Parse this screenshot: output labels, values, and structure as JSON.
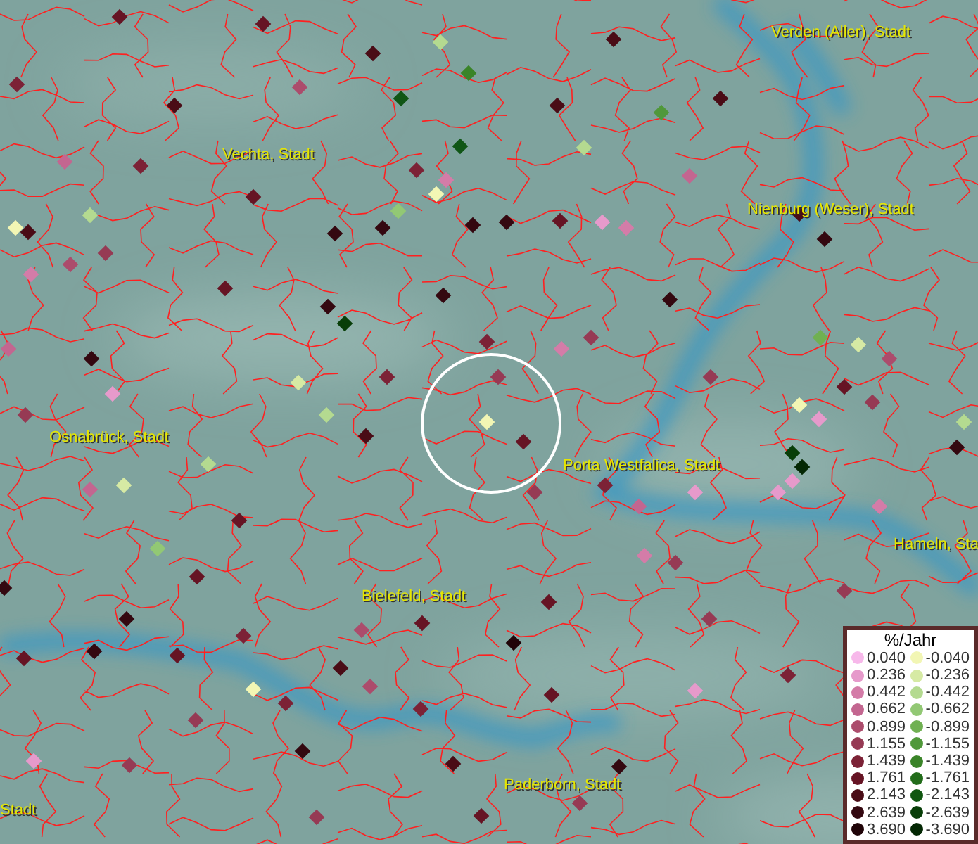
{
  "cities": [
    {
      "name": "Verden (Aller), Stadt"
    },
    {
      "name": "Vechta, Stadt"
    },
    {
      "name": "Nienburg (Weser), Stadt"
    },
    {
      "name": "Osnabrück, Stadt"
    },
    {
      "name": "Porta Westfalica, Stadt"
    },
    {
      "name": "Hameln, Sta"
    },
    {
      "name": "Bielefeld, Stadt"
    },
    {
      "name": "Paderborn, Stadt"
    },
    {
      "name": "Stadt"
    }
  ],
  "legend": {
    "title": "%/Jahr",
    "rows": [
      {
        "positive": {
          "label": "0.040",
          "color": "#f7b8ea"
        },
        "negative": {
          "label": "-0.040",
          "color": "#f2f6b4"
        }
      },
      {
        "positive": {
          "label": "0.236",
          "color": "#e69acb"
        },
        "negative": {
          "label": "-0.236",
          "color": "#d6eaa4"
        }
      },
      {
        "positive": {
          "label": "0.442",
          "color": "#d47ca8"
        },
        "negative": {
          "label": "-0.442",
          "color": "#b4da90"
        }
      },
      {
        "positive": {
          "label": "0.662",
          "color": "#c36690"
        },
        "negative": {
          "label": "-0.662",
          "color": "#92c874"
        }
      },
      {
        "positive": {
          "label": "0.899",
          "color": "#ac4c6c"
        },
        "negative": {
          "label": "-0.899",
          "color": "#70b052"
        }
      },
      {
        "positive": {
          "label": "1.155",
          "color": "#963a54"
        },
        "negative": {
          "label": "-1.155",
          "color": "#50983a"
        }
      },
      {
        "positive": {
          "label": "1.439",
          "color": "#7c2236"
        },
        "negative": {
          "label": "-1.439",
          "color": "#3a8428"
        }
      },
      {
        "positive": {
          "label": "1.761",
          "color": "#661424"
        },
        "negative": {
          "label": "-1.761",
          "color": "#226c1a"
        }
      },
      {
        "positive": {
          "label": "2.143",
          "color": "#4a0c16"
        },
        "negative": {
          "label": "-2.143",
          "color": "#105610"
        }
      },
      {
        "positive": {
          "label": "2.639",
          "color": "#340810"
        },
        "negative": {
          "label": "-2.639",
          "color": "#083e08"
        }
      },
      {
        "positive": {
          "label": "3.690",
          "color": "#200408"
        },
        "negative": {
          "label": "-3.690",
          "color": "#042804"
        }
      }
    ]
  }
}
